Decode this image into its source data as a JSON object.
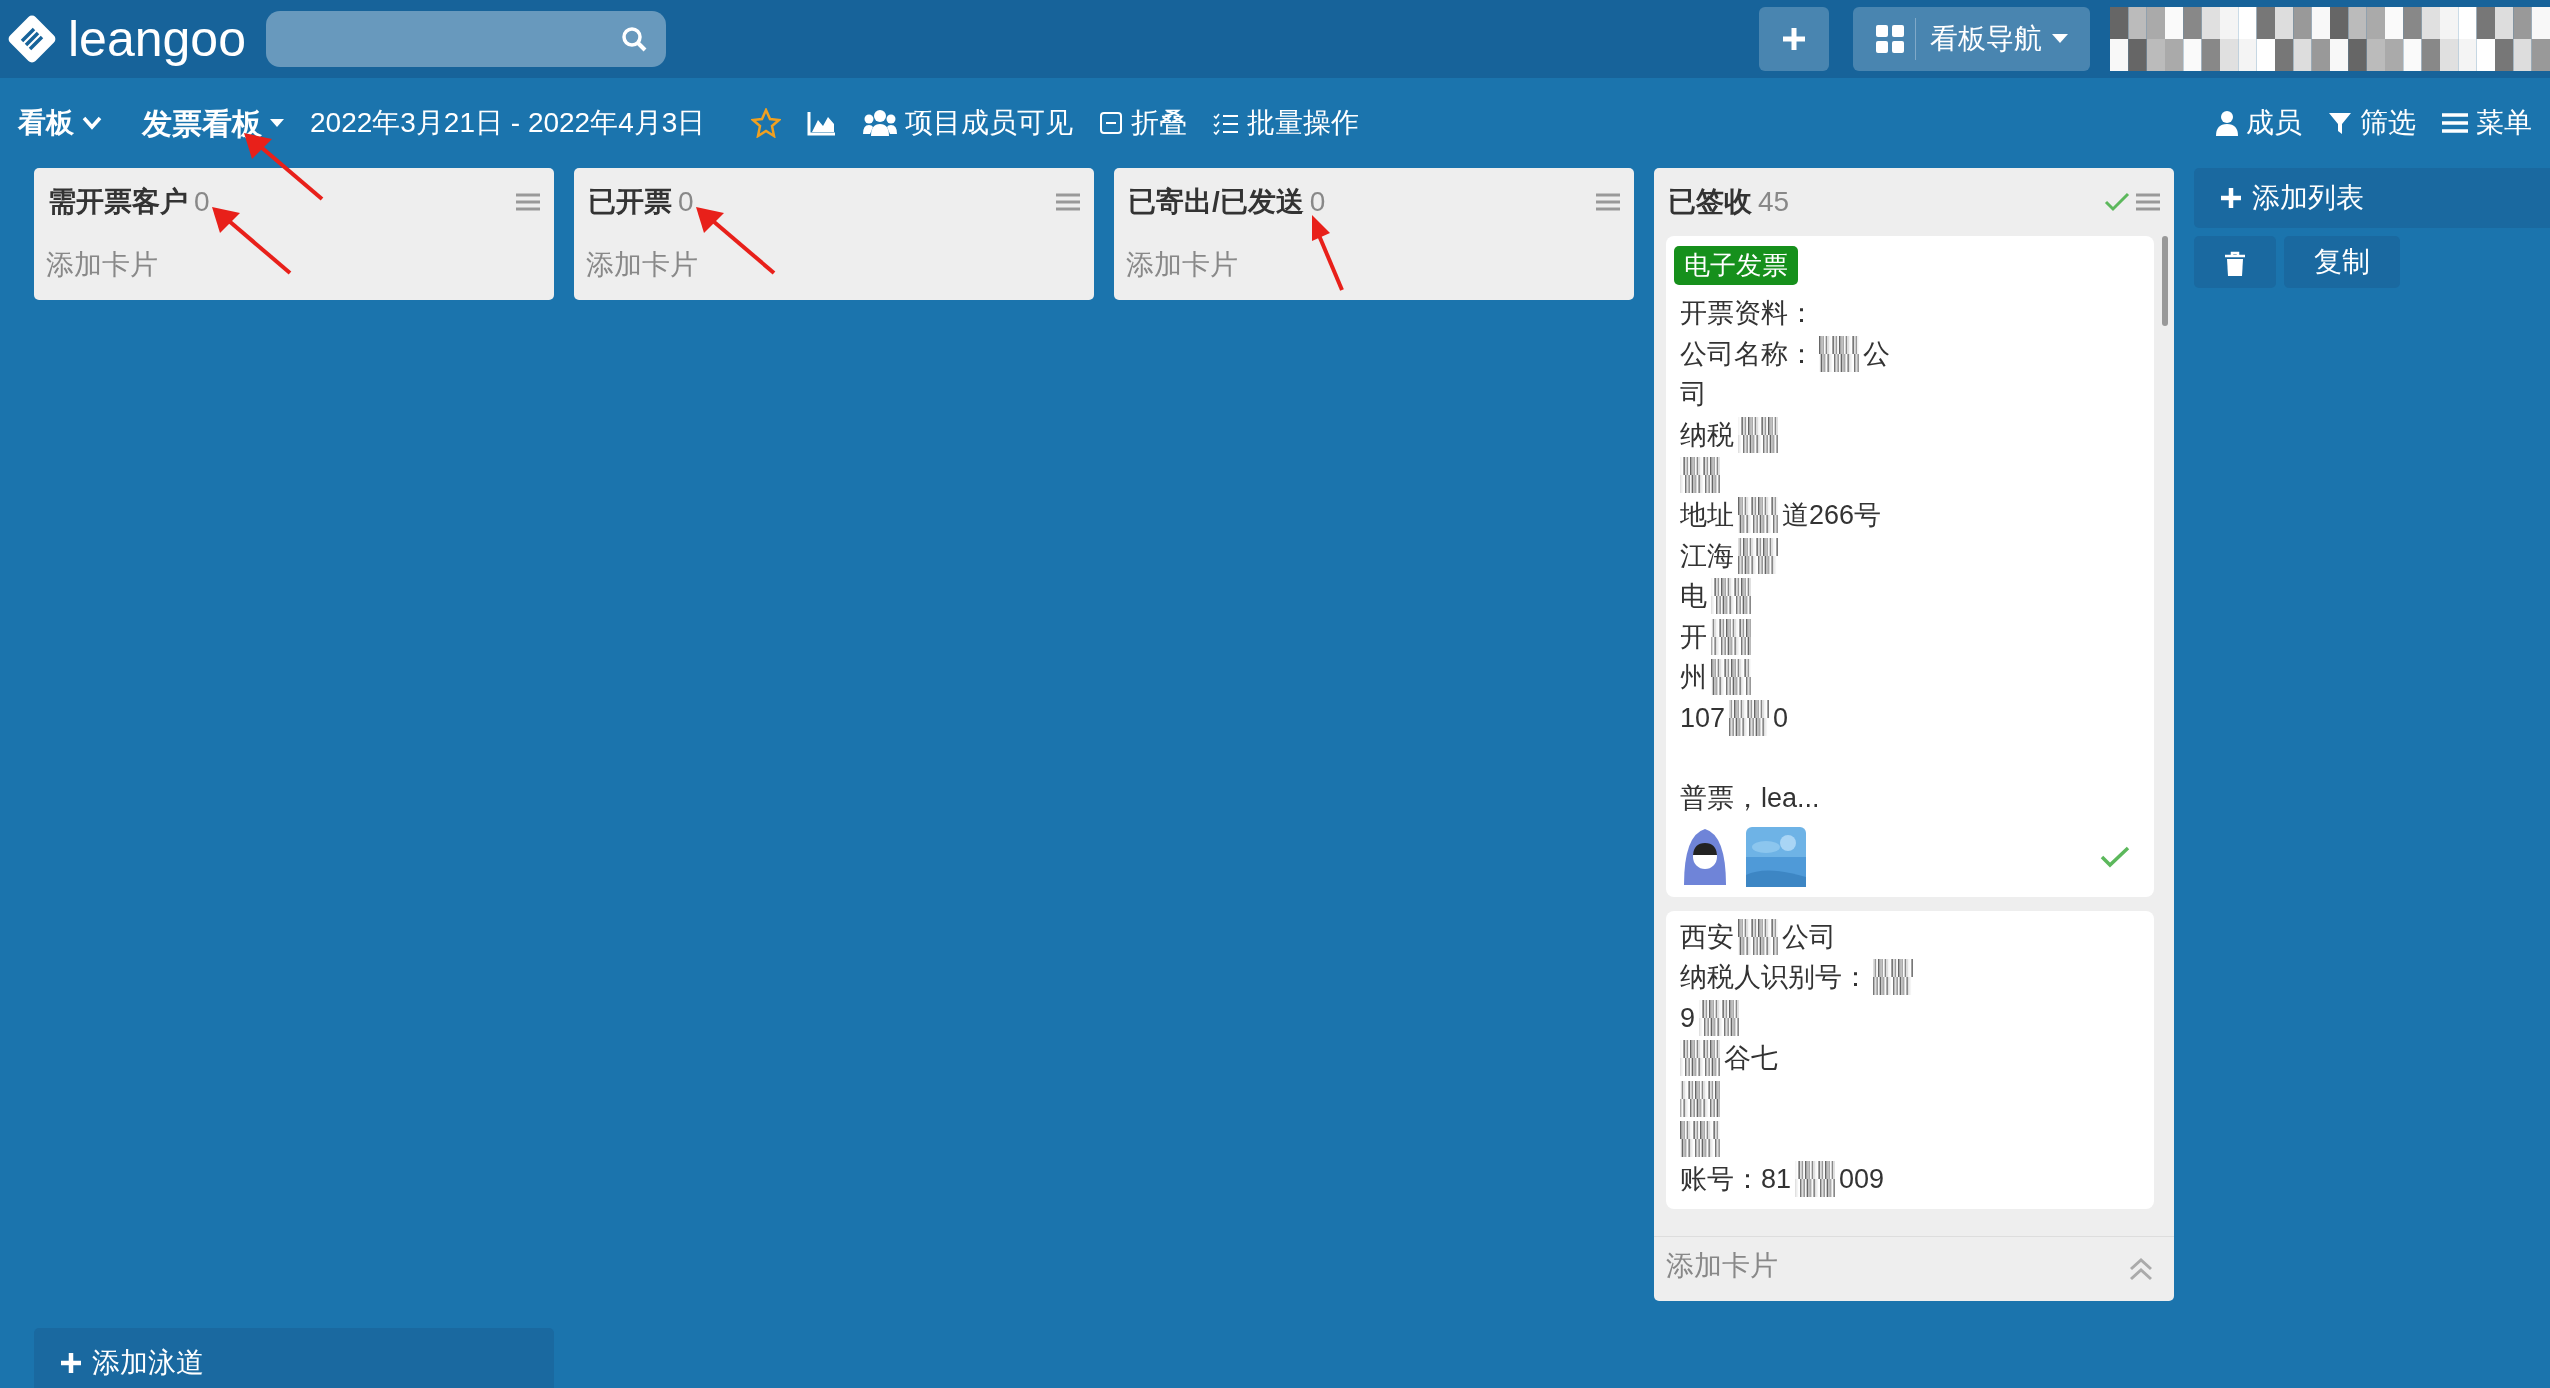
{
  "brand": {
    "name": "leangoo"
  },
  "top_actions": {
    "nav_label": "看板导航"
  },
  "toolbar": {
    "view_menu": "看板",
    "board_title": "发票看板",
    "board_title_pointed": true,
    "date_range": "2022年3月21日 - 2022年4月3日",
    "starred": false,
    "items": [
      {
        "kind": "chart"
      },
      {
        "kind": "members",
        "label": "项目成员可见"
      },
      {
        "kind": "collapse",
        "label": "折叠"
      },
      {
        "kind": "batch",
        "label": "批量操作"
      }
    ],
    "right_items": [
      {
        "kind": "person",
        "label": "成员"
      },
      {
        "kind": "filter",
        "label": "筛选"
      },
      {
        "kind": "menu",
        "label": "菜单"
      }
    ]
  },
  "lists": [
    {
      "title": "需开票客户",
      "count": "0",
      "pointed": true,
      "done": false,
      "add_card": "添加卡片"
    },
    {
      "title": "已开票",
      "count": "0",
      "pointed": true,
      "done": false,
      "add_card": "添加卡片"
    },
    {
      "title": "已寄出/已发送",
      "count": "0",
      "pointed": true,
      "done": false,
      "add_card": "添加卡片"
    },
    {
      "title": "已签收",
      "count": "45",
      "pointed": false,
      "done": true,
      "add_card": "添加卡片",
      "cards": [
        {
          "label": {
            "text": "电子发票",
            "color": "#16901c"
          },
          "done": true,
          "members": [
            {
              "kind": "figure"
            },
            {
              "kind": "picture"
            }
          ],
          "lines": [
            [
              {
                "kind": "text",
                "text": "开票资料："
              }
            ],
            [
              {
                "kind": "text",
                "text": "公司名称："
              },
              {
                "kind": "mosaic"
              },
              {
                "kind": "text",
                "text": "公"
              }
            ],
            [
              {
                "kind": "text",
                "text": "司"
              }
            ],
            [
              {
                "kind": "text",
                "text": "纳税"
              },
              {
                "kind": "mosaic"
              }
            ],
            [
              {
                "kind": "mosaic"
              }
            ],
            [
              {
                "kind": "text",
                "text": "地址"
              },
              {
                "kind": "mosaic"
              },
              {
                "kind": "text",
                "text": "道266号"
              }
            ],
            [
              {
                "kind": "text",
                "text": "江海"
              },
              {
                "kind": "mosaic"
              }
            ],
            [
              {
                "kind": "text",
                "text": "电"
              },
              {
                "kind": "mosaic"
              }
            ],
            [
              {
                "kind": "text",
                "text": "开"
              },
              {
                "kind": "mosaic"
              }
            ],
            [
              {
                "kind": "text",
                "text": "州"
              },
              {
                "kind": "mosaic"
              }
            ],
            [
              {
                "kind": "text",
                "text": "107"
              },
              {
                "kind": "mosaic"
              },
              {
                "kind": "text",
                "text": "0"
              }
            ],
            [
              {
                "kind": "blank"
              }
            ],
            [
              {
                "kind": "text",
                "text": "普票，lea..."
              }
            ]
          ]
        },
        {
          "done": false,
          "lines": [
            [
              {
                "kind": "text",
                "text": "西安"
              },
              {
                "kind": "mosaic"
              },
              {
                "kind": "text",
                "text": "公司"
              }
            ],
            [
              {
                "kind": "text",
                "text": "纳税人识别号："
              },
              {
                "kind": "mosaic"
              }
            ],
            [
              {
                "kind": "text",
                "text": "9"
              },
              {
                "kind": "mosaic"
              }
            ],
            [
              {
                "kind": "mosaic"
              },
              {
                "kind": "text",
                "text": "谷七"
              }
            ],
            [
              {
                "kind": "mosaic"
              }
            ],
            [
              {
                "kind": "mosaic"
              }
            ],
            [
              {
                "kind": "text",
                "text": "账号：81"
              },
              {
                "kind": "mosaic"
              },
              {
                "kind": "text",
                "text": "009"
              }
            ]
          ]
        }
      ]
    }
  ],
  "add_list": {
    "label": "添加列表",
    "copy": "复制"
  },
  "add_lane": "添加泳道"
}
